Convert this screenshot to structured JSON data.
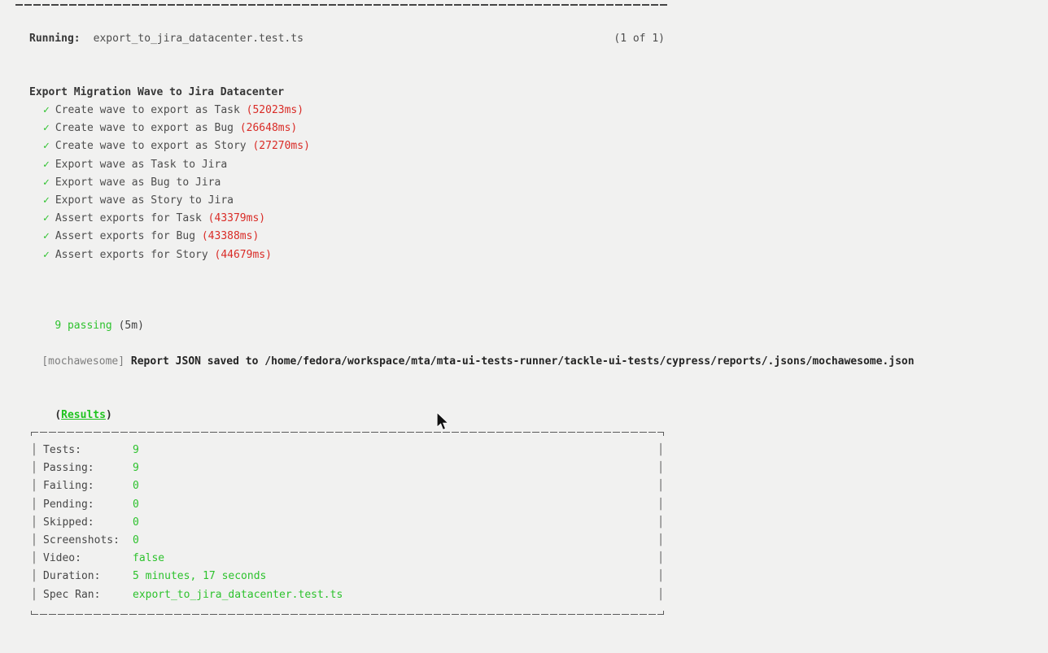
{
  "terminal": {
    "running": {
      "label": "Running:",
      "spec_file": "export_to_jira_datacenter.test.ts",
      "count": "(1 of 1)"
    },
    "suite_title": "Export Migration Wave to Jira Datacenter",
    "check_glyph": "✓",
    "tests": [
      {
        "name": "Create wave to export as Task ",
        "duration": "(52023ms)"
      },
      {
        "name": "Create wave to export as Bug ",
        "duration": "(26648ms)"
      },
      {
        "name": "Create wave to export as Story ",
        "duration": "(27270ms)"
      },
      {
        "name": "Export wave as Task to Jira",
        "duration": ""
      },
      {
        "name": "Export wave as Bug to Jira",
        "duration": ""
      },
      {
        "name": "Export wave as Story to Jira",
        "duration": ""
      },
      {
        "name": "Assert exports for Task ",
        "duration": "(43379ms)"
      },
      {
        "name": "Assert exports for Bug ",
        "duration": "(43388ms)"
      },
      {
        "name": "Assert exports for Story ",
        "duration": "(44679ms)"
      }
    ],
    "passing": {
      "count_text": "9 passing",
      "time_text": " (5m)"
    },
    "mochawesome": {
      "tag": "[mochawesome]",
      "message": " Report JSON saved to /home/fedora/workspace/mta/mta-ui-tests-runner/tackle-ui-tests/cypress/reports/.jsons/mochawesome.json"
    },
    "results": {
      "open": "(",
      "link": "Results",
      "close": ")"
    },
    "summary_rows": [
      {
        "label": "Tests:",
        "value": "9"
      },
      {
        "label": "Passing:",
        "value": "9"
      },
      {
        "label": "Failing:",
        "value": "0"
      },
      {
        "label": "Pending:",
        "value": "0"
      },
      {
        "label": "Skipped:",
        "value": "0"
      },
      {
        "label": "Screenshots:",
        "value": "0"
      },
      {
        "label": "Video:",
        "value": "false"
      },
      {
        "label": "Duration:",
        "value": "5 minutes, 17 seconds"
      },
      {
        "label": "Spec Ran:",
        "value": "export_to_jira_datacenter.test.ts"
      }
    ]
  },
  "colors": {
    "background": "#f1f1f0",
    "pass_green": "#2dc22d",
    "slow_red": "#d92b26",
    "text_gray": "#4d4d4d",
    "border_gray": "#5a5a5a"
  }
}
